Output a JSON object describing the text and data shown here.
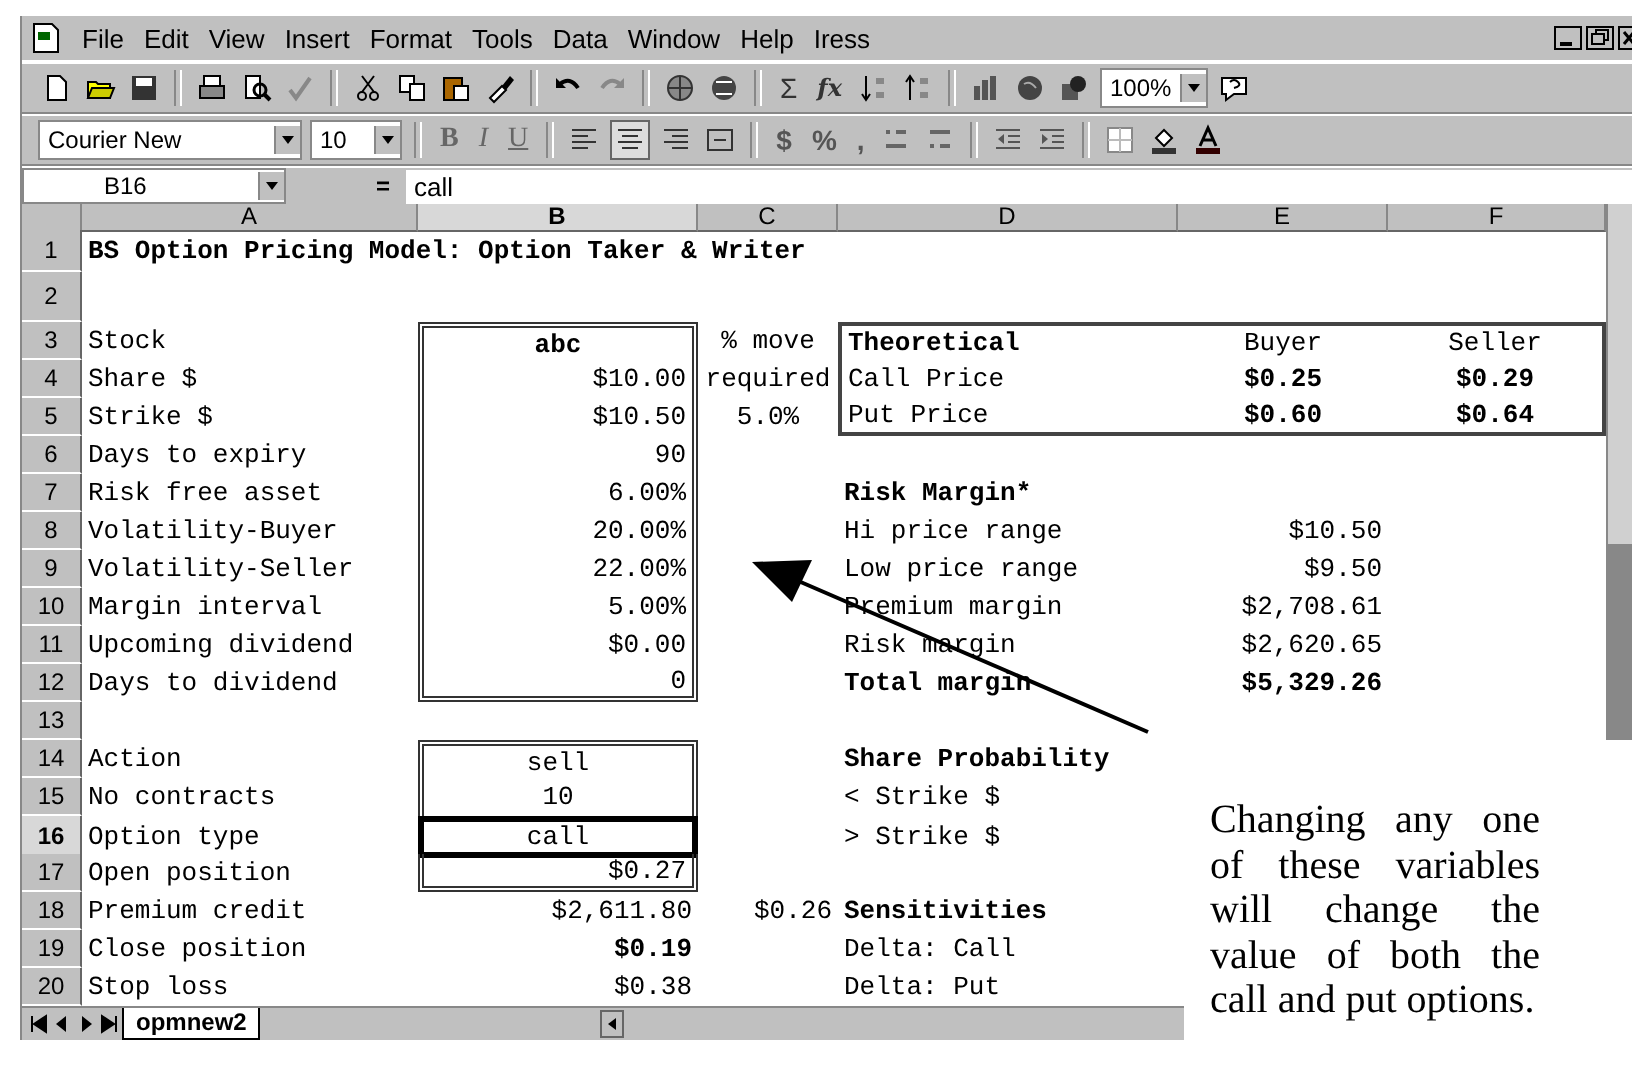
{
  "menu": [
    {
      "label": "File"
    },
    {
      "label": "Edit"
    },
    {
      "label": "View"
    },
    {
      "label": "Insert"
    },
    {
      "label": "Format"
    },
    {
      "label": "Tools"
    },
    {
      "label": "Data"
    },
    {
      "label": "Window"
    },
    {
      "label": "Help"
    },
    {
      "label": "Iress"
    }
  ],
  "toolbar": {
    "sum": "Σ",
    "function": "fx",
    "zoom": "100%",
    "font": "Courier New",
    "size": "10",
    "styles": [
      {
        "label": "B",
        "kind": "bold"
      },
      {
        "label": "I",
        "kind": "italic"
      },
      {
        "label": "U",
        "kind": "underline"
      }
    ],
    "number_formats": [
      {
        "label": "$"
      },
      {
        "label": "%"
      },
      {
        "label": ","
      }
    ]
  },
  "formula_bar": {
    "cell": "B16",
    "equals": "=",
    "value": "call"
  },
  "columns": [
    {
      "label": "A",
      "selected": false
    },
    {
      "label": "B",
      "selected": true
    },
    {
      "label": "C",
      "selected": false
    },
    {
      "label": "D",
      "selected": false
    },
    {
      "label": "E",
      "selected": false
    },
    {
      "label": "F",
      "selected": false
    }
  ],
  "rows": [
    {
      "label": "1",
      "selected": false,
      "cells": {
        "a": {
          "text": "BS Option Pricing Model: Option Taker & Writer",
          "bold": true
        }
      }
    },
    {
      "label": "2",
      "selected": false,
      "cells": {}
    },
    {
      "label": "3",
      "selected": false,
      "cells": {
        "a": {
          "text": "Stock"
        },
        "b": {
          "text": "abc",
          "bold": true,
          "centered": true
        },
        "c": {
          "text": "% move",
          "centered": true
        },
        "d": {
          "text": "Theoretical",
          "bold": true
        },
        "e": {
          "text": "Buyer",
          "centered": true
        },
        "f": {
          "text": "Seller",
          "centered": true
        }
      }
    },
    {
      "label": "4",
      "selected": false,
      "cells": {
        "a": {
          "text": "Share $"
        },
        "b": {
          "text": "$10.00"
        },
        "c": {
          "text": "required",
          "centered": true
        },
        "d": {
          "text": "Call Price"
        },
        "e": {
          "text": "$0.25",
          "bold": true,
          "centered": true
        },
        "f": {
          "text": "$0.29",
          "bold": true,
          "centered": true
        }
      }
    },
    {
      "label": "5",
      "selected": false,
      "cells": {
        "a": {
          "text": "Strike $"
        },
        "b": {
          "text": "$10.50"
        },
        "c": {
          "text": "5.0%",
          "centered": true
        },
        "d": {
          "text": "Put Price"
        },
        "e": {
          "text": "$0.60",
          "bold": true,
          "centered": true
        },
        "f": {
          "text": "$0.64",
          "bold": true,
          "centered": true
        }
      }
    },
    {
      "label": "6",
      "selected": false,
      "cells": {
        "a": {
          "text": "Days to expiry"
        },
        "b": {
          "text": "90"
        }
      }
    },
    {
      "label": "7",
      "selected": false,
      "cells": {
        "a": {
          "text": "Risk free asset"
        },
        "b": {
          "text": "6.00%"
        },
        "d": {
          "text": "Risk Margin*",
          "bold": true
        }
      }
    },
    {
      "label": "8",
      "selected": false,
      "cells": {
        "a": {
          "text": "Volatility-Buyer"
        },
        "b": {
          "text": "20.00%"
        },
        "d": {
          "text": "Hi price range"
        },
        "e": {
          "text": "$10.50"
        }
      }
    },
    {
      "label": "9",
      "selected": false,
      "cells": {
        "a": {
          "text": "Volatility-Seller"
        },
        "b": {
          "text": "22.00%"
        },
        "d": {
          "text": "Low price range"
        },
        "e": {
          "text": "$9.50"
        }
      }
    },
    {
      "label": "10",
      "selected": false,
      "cells": {
        "a": {
          "text": "Margin interval"
        },
        "b": {
          "text": "5.00%"
        },
        "d": {
          "text": "Premium margin"
        },
        "e": {
          "text": "$2,708.61"
        }
      }
    },
    {
      "label": "11",
      "selected": false,
      "cells": {
        "a": {
          "text": "Upcoming dividend"
        },
        "b": {
          "text": "$0.00"
        },
        "d": {
          "text": "Risk margin"
        },
        "e": {
          "text": "$2,620.65"
        }
      }
    },
    {
      "label": "12",
      "selected": false,
      "cells": {
        "a": {
          "text": "Days to dividend"
        },
        "b": {
          "text": "0"
        },
        "d": {
          "text": "Total margin",
          "bold": true
        },
        "e": {
          "text": "$5,329.26",
          "bold": true
        }
      }
    },
    {
      "label": "13",
      "selected": false,
      "cells": {}
    },
    {
      "label": "14",
      "selected": false,
      "cells": {
        "a": {
          "text": "Action"
        },
        "b": {
          "text": "sell",
          "centered": true
        },
        "d": {
          "text": "Share Probability",
          "bold": true
        }
      }
    },
    {
      "label": "15",
      "selected": false,
      "cells": {
        "a": {
          "text": "No contracts"
        },
        "b": {
          "text": "10",
          "centered": true
        },
        "d": {
          "text": "< Strike $"
        }
      }
    },
    {
      "label": "16",
      "selected": true,
      "cells": {
        "a": {
          "text": "Option type"
        },
        "b": {
          "text": "call",
          "centered": true
        },
        "d": {
          "text": "> Strike $"
        }
      }
    },
    {
      "label": "17",
      "selected": false,
      "cells": {
        "a": {
          "text": "Open position"
        },
        "b": {
          "text": "$0.27"
        }
      }
    },
    {
      "label": "18",
      "selected": false,
      "cells": {
        "a": {
          "text": "Premium credit"
        },
        "b": {
          "text": "$2,611.80"
        },
        "c": {
          "text": "$0.26"
        },
        "d": {
          "text": "Sensitivities",
          "bold": true
        }
      }
    },
    {
      "label": "19",
      "selected": false,
      "cells": {
        "a": {
          "text": "Close position"
        },
        "b": {
          "text": "$0.19",
          "bold": true
        },
        "d": {
          "text": "Delta: Call"
        }
      }
    },
    {
      "label": "20",
      "selected": false,
      "cells": {
        "a": {
          "text": "Stop loss"
        },
        "b": {
          "text": "$0.38"
        },
        "d": {
          "text": "Delta: Put"
        }
      }
    }
  ],
  "sheet_tabs": [
    {
      "label": "opmnew2",
      "selected": true
    }
  ],
  "annotation": {
    "text": "Changing any one of these variables will change the value of both the call and put options."
  }
}
